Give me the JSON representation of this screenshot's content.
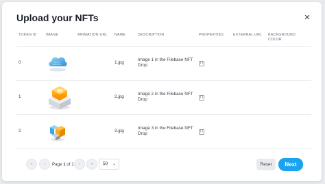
{
  "modal": {
    "title": "Upload your NFTs",
    "close_icon": "close-icon",
    "close_glyph": "×"
  },
  "table": {
    "headers": [
      "TOKEN ID",
      "IMAGE",
      "ANIMATION URL",
      "NAME",
      "DESCRIPTION",
      "PROPERTIES",
      "EXTERNAL URL",
      "BACKGROUND COLOR"
    ],
    "rows": [
      {
        "token_id": "0",
        "image_icon": "cloud-image",
        "animation_url": "",
        "name": "1.jpg",
        "description": "Image 1 in the Filebase NFT Drop",
        "properties_icon": "json-brace-icon",
        "properties_glyph": "{}",
        "external_url": "",
        "background_color": ""
      },
      {
        "token_id": "1",
        "image_icon": "server-cube-image",
        "animation_url": "",
        "name": "2.jpg",
        "description": "Image 2 in the Filebase NFT Drop",
        "properties_icon": "json-brace-icon",
        "properties_glyph": "{}",
        "external_url": "",
        "background_color": ""
      },
      {
        "token_id": "2",
        "image_icon": "cube-stack-image",
        "animation_url": "",
        "name": "3.jpg",
        "description": "Image 3 in the Filebase NFT Drop",
        "properties_icon": "json-brace-icon",
        "properties_glyph": "{}",
        "external_url": "",
        "background_color": ""
      }
    ]
  },
  "pagination": {
    "first_glyph": "«",
    "prev_glyph": "‹",
    "next_glyph": "›",
    "last_glyph": "»",
    "page_label": "Page",
    "current_page": "1",
    "of_label": "of",
    "total_pages": "1",
    "per_page_value": "50",
    "chevron_glyph": "⌄"
  },
  "actions": {
    "reset_label": "Reset",
    "next_label": "Next"
  },
  "colors": {
    "accent": "#1aa3ee",
    "reset_bg": "#e8eaed",
    "backdrop": "#e8eaee"
  }
}
